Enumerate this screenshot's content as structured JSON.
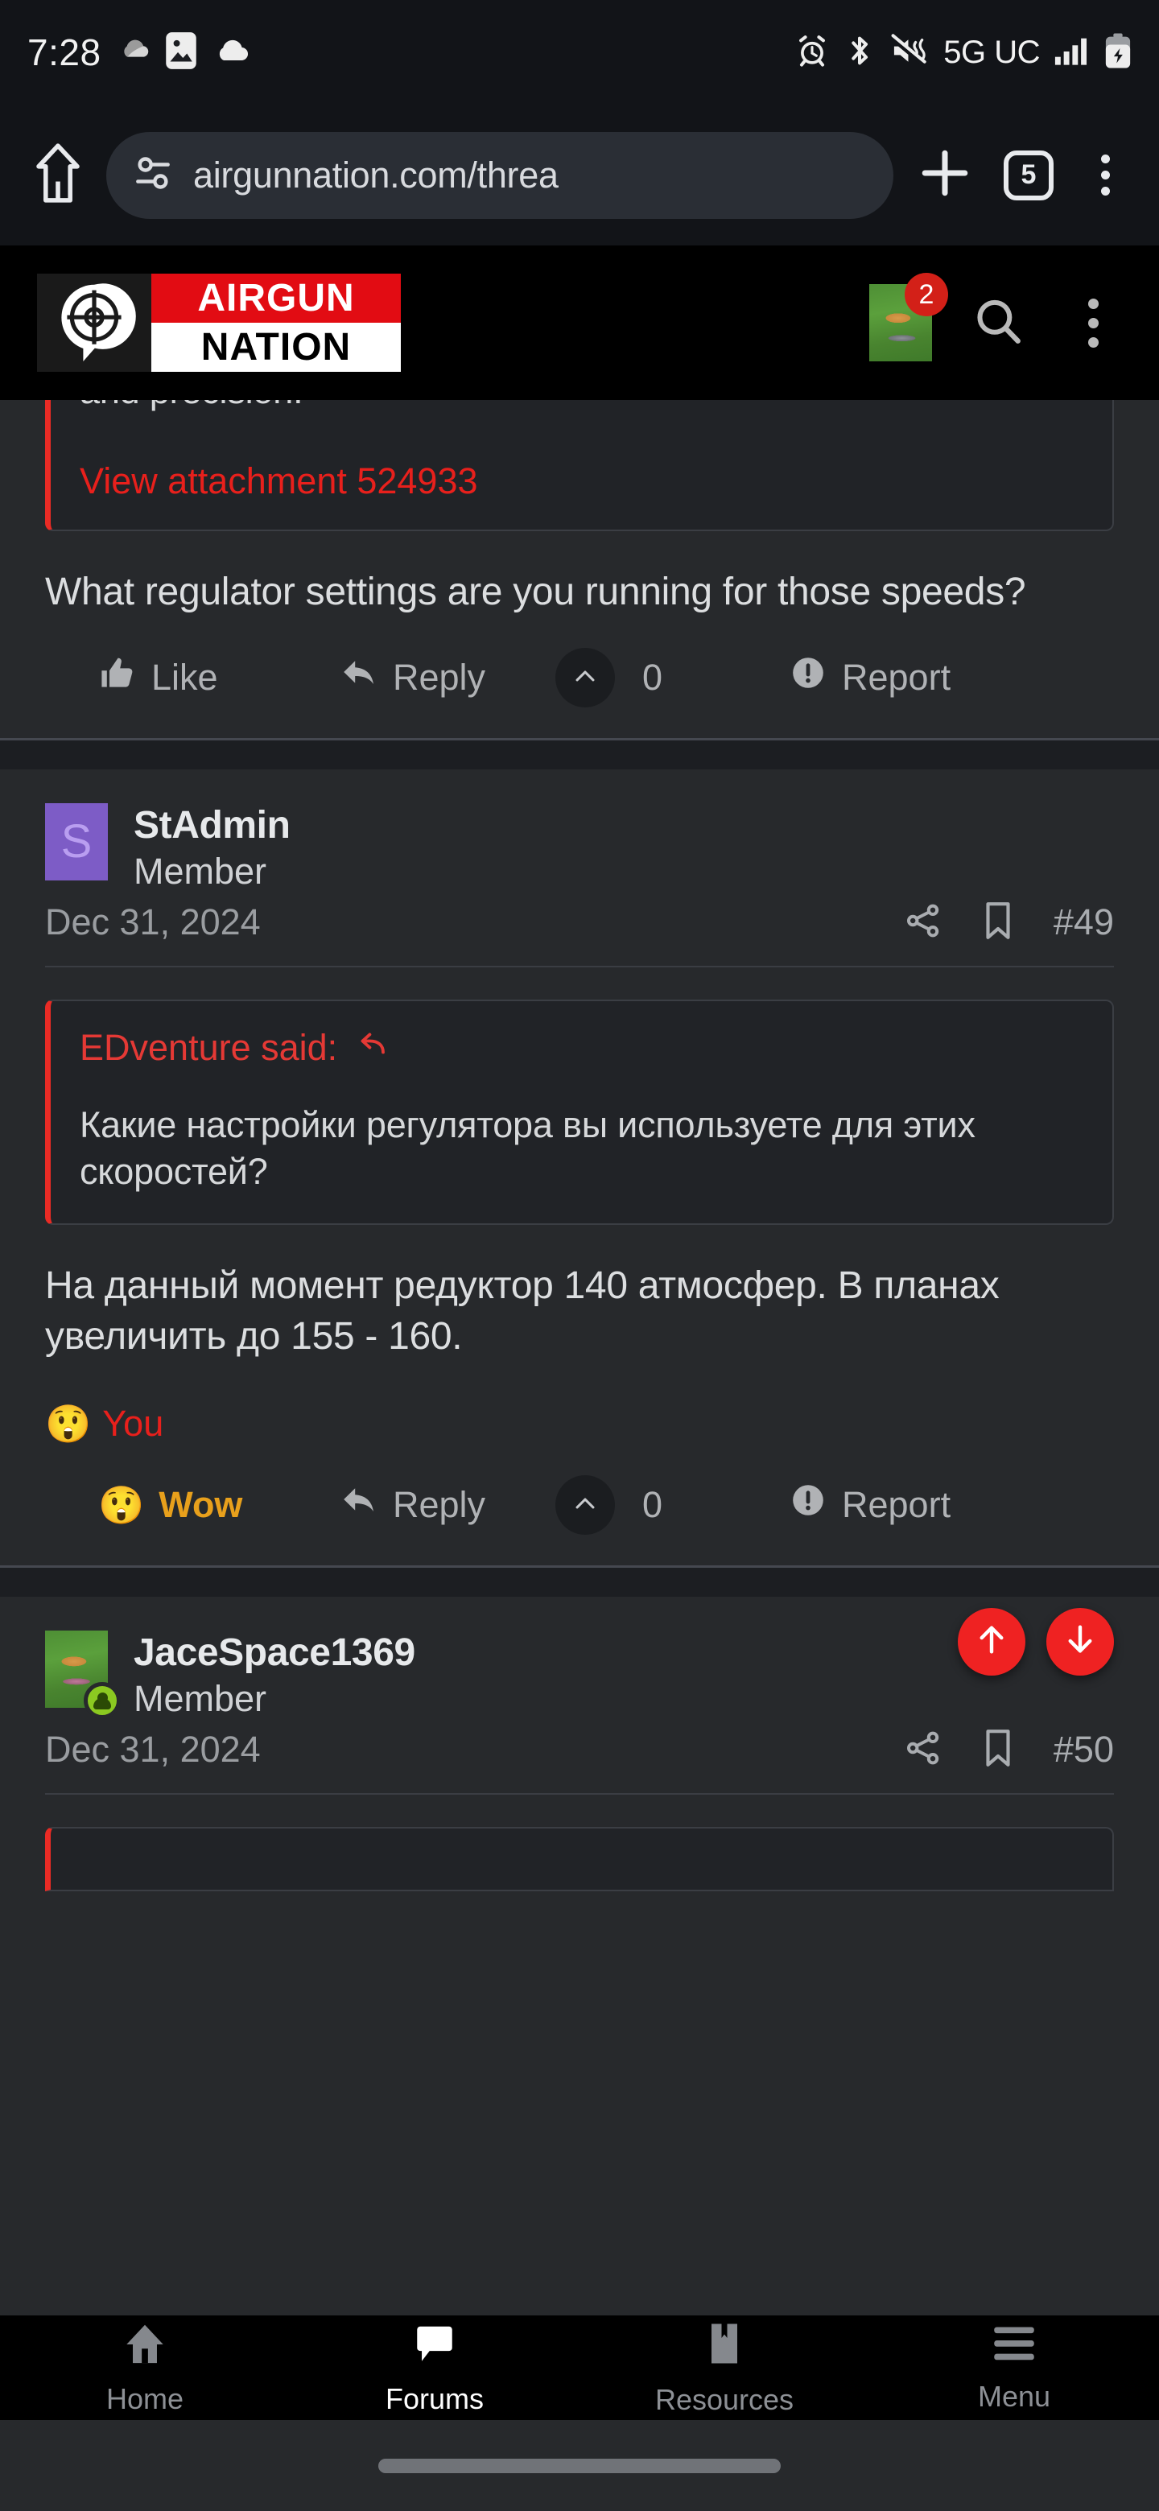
{
  "status_bar": {
    "time": "7:28",
    "left_icons": [
      "weather-cloud-icon",
      "photos-icon",
      "cloud-icon"
    ],
    "right_icons": [
      "alarm-icon",
      "bluetooth-icon",
      "vibrate-mute-icon",
      "signal-bars-icon",
      "battery-charging-icon"
    ],
    "network": "5G UC"
  },
  "browser": {
    "home_icon": "home-icon",
    "site_settings_icon": "tune-permissions-icon",
    "url": "airgunnation.com/threa",
    "new_tab_icon": "plus-icon",
    "tab_count": "5",
    "menu_icon": "three-dot-menu-icon"
  },
  "site_header": {
    "logo_top": "AIRGUN",
    "logo_bottom": "NATION",
    "logo_mark": "crosshair-scope-icon",
    "avatar_name": "user-avatar",
    "notification_count": "2",
    "search_icon": "search-icon",
    "menu_icon": "three-dot-menu-icon"
  },
  "colors": {
    "accent_red": "#ea2b25",
    "link_red": "#e8201c",
    "brand_red": "#e20c13",
    "page_bg": "#27292c",
    "quote_bg": "#212327",
    "avatar_purple": "#7d5cc6",
    "gold": "#e8a01c",
    "online_green": "#8bc921"
  },
  "posts": [
    {
      "id": "post-partial-top",
      "quote": {
        "text": "and precision.",
        "attachment_link": "View attachment 524933"
      },
      "body": "What regulator settings are you running for those speeds?",
      "actions": {
        "like_label": "Like",
        "like_icon": "thumbs-up-icon",
        "reply_label": "Reply",
        "reply_icon": "reply-arrow-icon",
        "vote_icon": "chevron-up-icon",
        "vote_count": "0",
        "report_label": "Report",
        "report_icon": "exclamation-circle-icon"
      }
    },
    {
      "id": "post-49",
      "author": "StAdmin",
      "author_initial": "S",
      "user_title": "Member",
      "date": "Dec 31, 2024",
      "share_icon": "share-icon",
      "bookmark_icon": "bookmark-icon",
      "post_number": "#49",
      "quote": {
        "attribution": "EDventure said:",
        "attribution_icon": "jump-to-quote-icon",
        "text": "Какие настройки регулятора вы используете для этих скоростей?"
      },
      "body": "На данный момент редуктор 140 атмосфер. В планах увеличить до 155 - 160.",
      "reaction": {
        "emoji": "😲",
        "label": "You"
      },
      "actions": {
        "like_label": "Wow",
        "like_icon": "astonished-face-icon",
        "reply_label": "Reply",
        "reply_icon": "reply-arrow-icon",
        "vote_icon": "chevron-up-icon",
        "vote_count": "0",
        "report_label": "Report",
        "report_icon": "exclamation-circle-icon"
      }
    },
    {
      "id": "post-50",
      "author": "JaceSpace1369",
      "user_title": "Member",
      "date": "Dec 31, 2024",
      "share_icon": "share-icon",
      "bookmark_icon": "bookmark-icon",
      "post_number": "#50",
      "scroll_up_icon": "arrow-up-icon",
      "scroll_down_icon": "arrow-down-icon",
      "online_badge": "online-status-icon"
    }
  ],
  "bottom_nav": {
    "items": [
      {
        "label": "Home",
        "icon": "house-icon",
        "active": false
      },
      {
        "label": "Forums",
        "icon": "speech-bubble-icon",
        "active": true
      },
      {
        "label": "Resources",
        "icon": "bookmark-icon",
        "active": false
      },
      {
        "label": "Menu",
        "icon": "hamburger-menu-icon",
        "active": false
      }
    ]
  }
}
